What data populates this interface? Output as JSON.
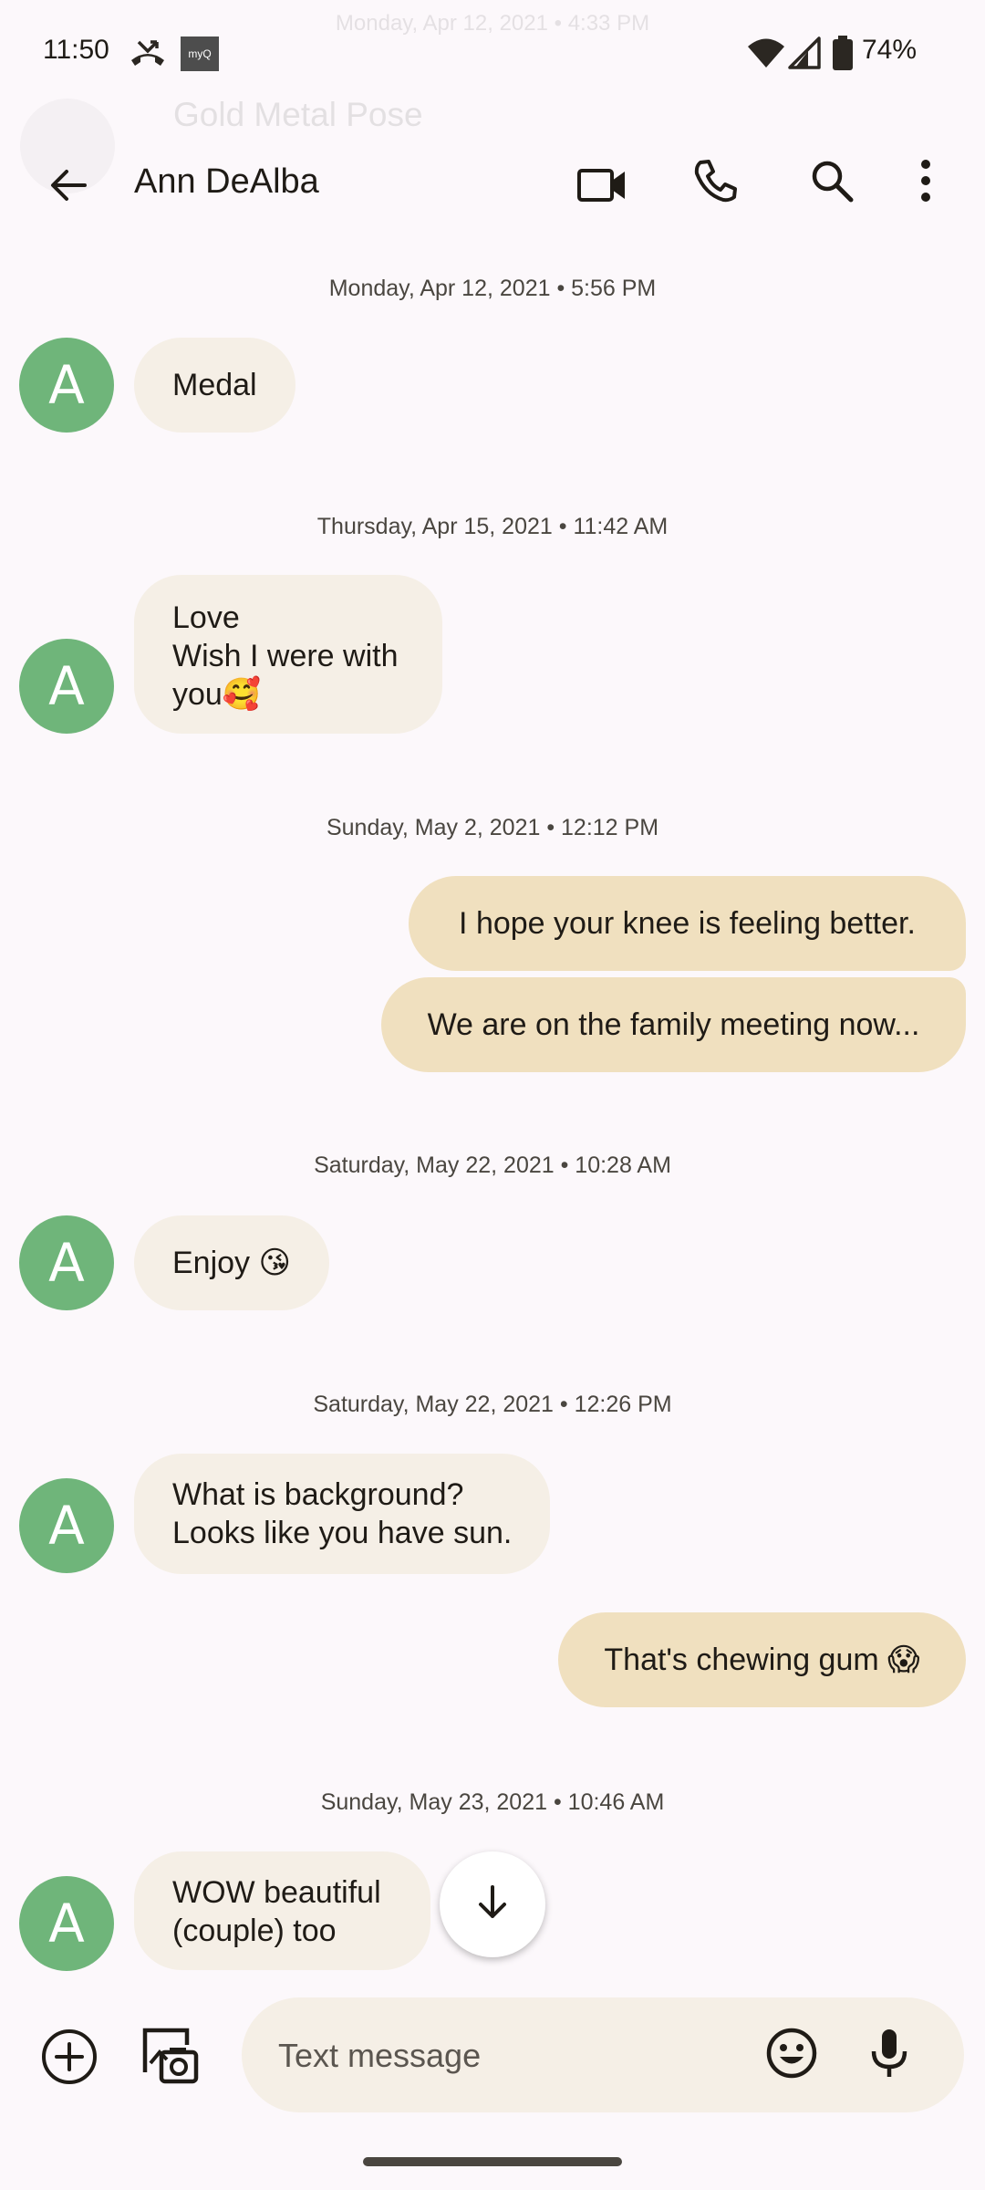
{
  "status_bar": {
    "time": "11:50",
    "app_badge": "myQ",
    "battery": "74%"
  },
  "ghost": {
    "date": "Monday, Apr 12, 2021 • 4:33 PM",
    "title": "Gold Metal Pose"
  },
  "header": {
    "title": "Ann DeAlba",
    "icons": [
      "back-arrow-icon",
      "video-call-icon",
      "phone-icon",
      "search-icon",
      "more-vert-icon"
    ]
  },
  "avatar_letter": "A",
  "colors": {
    "background": "#fcf8fb",
    "incoming_bubble": "#f5efe6",
    "outgoing_bubble": "#f0e0bf",
    "avatar": "#6fb57a"
  },
  "thread": {
    "ts1": "Monday, Apr 12, 2021 • 5:56 PM",
    "msg1": "Medal",
    "ts2": "Thursday, Apr 15, 2021 • 11:42 AM",
    "msg2": "Love\nWish I were with\nyou🥰",
    "ts3": "Sunday, May 2, 2021 • 12:12 PM",
    "msg3": "I hope your knee is feeling better.",
    "msg4": "We are on the family meeting now...",
    "ts4": "Saturday, May 22, 2021 • 10:28 AM",
    "msg5": "Enjoy 😘",
    "ts5": "Saturday, May 22, 2021 • 12:26 PM",
    "msg6": "What is background?\nLooks like you have sun.",
    "msg7": "That's chewing gum 😱",
    "ts6": "Sunday, May 23, 2021 • 10:46 AM",
    "msg8": "WOW beautiful\n(couple) too"
  },
  "compose": {
    "placeholder": "Text message"
  }
}
